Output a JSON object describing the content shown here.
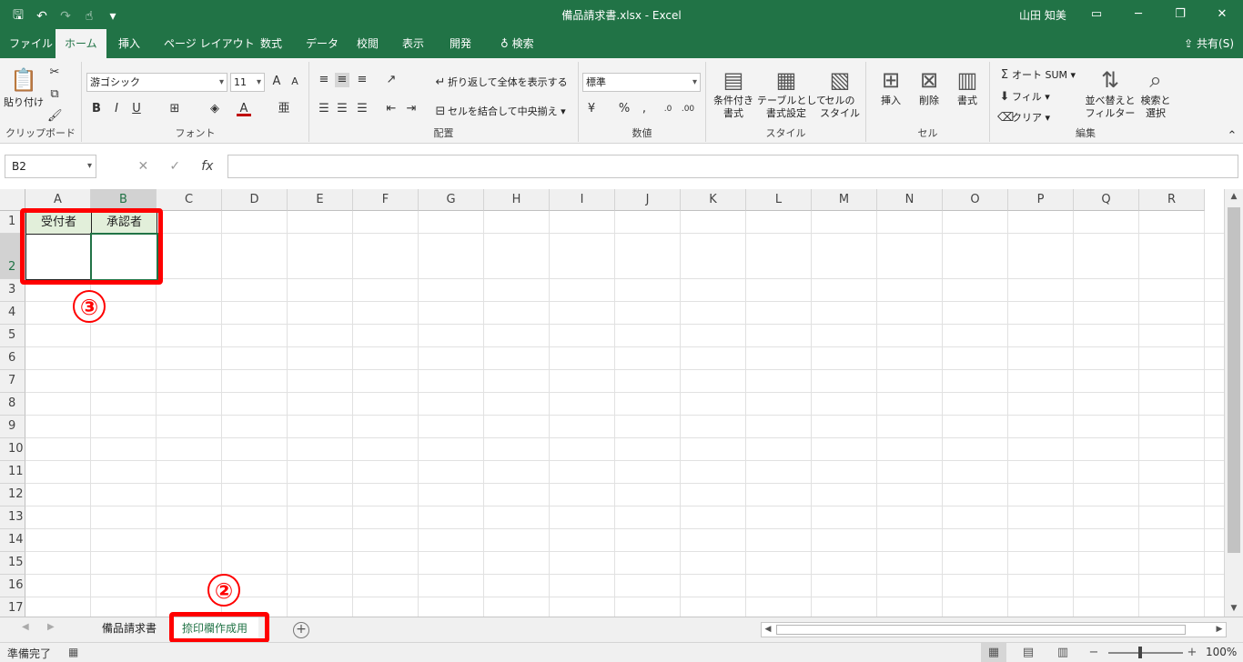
{
  "title_bar": {
    "title": "備品請求書.xlsx  -  Excel",
    "user": "山田 知美",
    "qat_icons": [
      "save-icon",
      "undo-icon",
      "redo-icon",
      "touch-mode-icon",
      "customize-icon"
    ]
  },
  "tabs": [
    {
      "label": "ファイル",
      "active": false
    },
    {
      "label": "ホーム",
      "active": true
    },
    {
      "label": "挿入",
      "active": false
    },
    {
      "label": "ページ レイアウト",
      "active": false
    },
    {
      "label": "数式",
      "active": false
    },
    {
      "label": "データ",
      "active": false
    },
    {
      "label": "校閲",
      "active": false
    },
    {
      "label": "表示",
      "active": false
    },
    {
      "label": "開発",
      "active": false
    },
    {
      "label": "検索",
      "active": false
    }
  ],
  "share_label": "共有(S)",
  "ribbon": {
    "clipboard": {
      "label": "クリップボード",
      "paste": "貼り付け"
    },
    "font": {
      "label": "フォント",
      "font_name": "游ゴシック",
      "font_size": "11"
    },
    "alignment": {
      "label": "配置",
      "wrap": "折り返して全体を表示する",
      "merge": "セルを結合して中央揃え"
    },
    "number": {
      "label": "数値",
      "format": "標準"
    },
    "styles": {
      "label": "スタイル",
      "cond_1": "条件付き",
      "cond_2": "書式",
      "table_1": "テーブルとして",
      "table_2": "書式設定",
      "cell_1": "セルの",
      "cell_2": "スタイル"
    },
    "cells": {
      "label": "セル",
      "insert": "挿入",
      "delete": "削除",
      "format": "書式"
    },
    "editing": {
      "label": "編集",
      "autosum": "オート SUM",
      "fill": "フィル",
      "clear": "クリア",
      "sort_1": "並べ替えと",
      "sort_2": "フィルター",
      "find_1": "検索と",
      "find_2": "選択"
    }
  },
  "formula_bar": {
    "name_box": "B2",
    "value": ""
  },
  "columns": [
    "A",
    "B",
    "C",
    "D",
    "E",
    "F",
    "G",
    "H",
    "I",
    "J",
    "K",
    "L",
    "M",
    "N",
    "O",
    "P",
    "Q",
    "R"
  ],
  "selected_column": "B",
  "rows": [
    "1",
    "2",
    "3",
    "4",
    "5",
    "6",
    "7",
    "8",
    "9",
    "10",
    "11",
    "12",
    "13",
    "14",
    "15",
    "16",
    "17"
  ],
  "selected_row": "2",
  "cells": {
    "A1": "受付者",
    "B1": "承認者"
  },
  "annotations": {
    "badge_3": "③",
    "badge_2": "②"
  },
  "sheets": [
    {
      "label": "備品請求書",
      "active": false
    },
    {
      "label": "捺印欄作成用",
      "active": true
    }
  ],
  "status": {
    "text": "準備完了",
    "zoom": "100%"
  },
  "colors": {
    "accent": "#217346",
    "header_fill": "#e2efda",
    "highlight": "#ff0000"
  }
}
